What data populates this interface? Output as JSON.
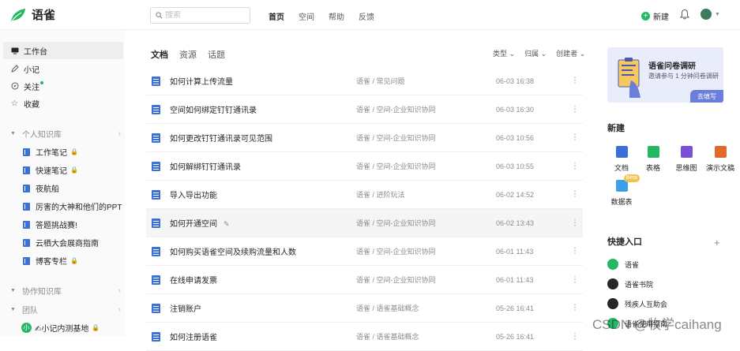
{
  "brand": {
    "name": "语雀",
    "color": "#25b864"
  },
  "topbar": {
    "search_placeholder": "搜索",
    "nav": [
      {
        "label": "首页",
        "active": true
      },
      {
        "label": "空间",
        "active": false
      },
      {
        "label": "帮助",
        "active": false
      },
      {
        "label": "反馈",
        "active": false
      }
    ],
    "new_label": "新建",
    "icons": [
      "search-icon",
      "bell-icon",
      "avatar",
      "chevron-down-icon"
    ]
  },
  "sidebar": {
    "items": [
      {
        "label": "工作台",
        "icon": "desktop-icon",
        "active": true
      },
      {
        "label": "小记",
        "icon": "pen-icon",
        "active": false
      },
      {
        "label": "关注",
        "icon": "compass-icon",
        "active": false
      },
      {
        "label": "收藏",
        "icon": "star-icon",
        "active": false
      }
    ],
    "personal_group": "个人知识库",
    "books": [
      {
        "label": "工作笔记",
        "locked": true
      },
      {
        "label": "快速笔记",
        "locked": true
      },
      {
        "label": "夜航船",
        "locked": false
      },
      {
        "label": "厉害的大神和他们的PPT",
        "locked": false
      },
      {
        "label": "答题挑战赛!",
        "locked": false
      },
      {
        "label": "云栖大会展商指南",
        "locked": false
      },
      {
        "label": "博客专栏",
        "locked": true
      }
    ],
    "collab_group": "协作知识库",
    "team_group": "团队",
    "team": {
      "badge": "小",
      "label": "✍小记内测基地",
      "locked": true
    }
  },
  "main": {
    "tabs": [
      {
        "label": "文档",
        "active": true
      },
      {
        "label": "资源",
        "active": false
      },
      {
        "label": "话题",
        "active": false
      }
    ],
    "filters": [
      "类型",
      "归属",
      "创建者"
    ],
    "rows": [
      {
        "title": "如何计算上传流量",
        "path": "语雀 / 常见问题",
        "time": "06-03 16:38",
        "hover": false
      },
      {
        "title": "空间如何绑定钉钉通讯录",
        "path": "语雀 / 空间-企业知识协同",
        "time": "06-03 16:30",
        "hover": false
      },
      {
        "title": "如何更改钉钉通讯录可见范围",
        "path": "语雀 / 空间-企业知识协同",
        "time": "06-03 10:56",
        "hover": false
      },
      {
        "title": "如何解绑钉钉通讯录",
        "path": "语雀 / 空间-企业知识协同",
        "time": "06-03 10:55",
        "hover": false
      },
      {
        "title": "导入导出功能",
        "path": "语雀 / 进阶玩法",
        "time": "06-02 14:52",
        "hover": false
      },
      {
        "title": "如何开通空间",
        "path": "语雀 / 空间-企业知识协同",
        "time": "06-02 13:43",
        "hover": true
      },
      {
        "title": "如何购买语雀空间及续购流量和人数",
        "path": "语雀 / 空间-企业知识协同",
        "time": "06-01 11:43",
        "hover": false
      },
      {
        "title": "在线申请发票",
        "path": "语雀 / 空间-企业知识协同",
        "time": "06-01 11:43",
        "hover": false
      },
      {
        "title": "注销账户",
        "path": "语雀 / 语雀基础概念",
        "time": "05-26 16:41",
        "hover": false
      },
      {
        "title": "如何注册语雀",
        "path": "语雀 / 语雀基础概念",
        "time": "05-26 16:41",
        "hover": false
      }
    ]
  },
  "right": {
    "banner": {
      "title": "语雀问卷调研",
      "subtitle": "邀请参与 1 分钟问卷调研",
      "button": "去填写"
    },
    "new_title": "新建",
    "new_items": [
      {
        "label": "文档",
        "color": "#3c6fd8",
        "icon": "doc-icon"
      },
      {
        "label": "表格",
        "color": "#25b864",
        "icon": "sheet-icon"
      },
      {
        "label": "思维图",
        "color": "#7b4fd6",
        "icon": "mindmap-icon"
      },
      {
        "label": "演示文稿",
        "color": "#e2692c",
        "icon": "slides-icon"
      },
      {
        "label": "数据表",
        "color": "#3c9fe8",
        "icon": "table-icon",
        "badge": "Beta"
      }
    ],
    "quick_title": "快捷入口",
    "quick_items": [
      {
        "label": "语雀",
        "color": "#25b864"
      },
      {
        "label": "语雀书院",
        "color": "#262626"
      },
      {
        "label": "残疾人互助会",
        "color": "#262626"
      },
      {
        "label": "语雀使用指南",
        "color": "#25b864"
      }
    ]
  },
  "watermark": "CSDN @牧学caihang"
}
